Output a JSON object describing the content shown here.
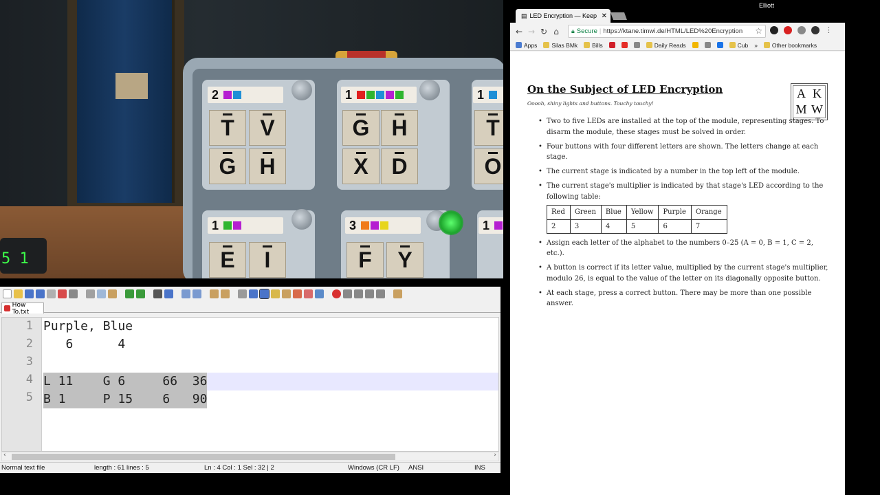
{
  "game": {
    "clock_text": "5 1",
    "modules": [
      {
        "stage": "2",
        "leds": [
          "#b51fd1",
          "#1f8fd6"
        ],
        "letters": [
          "T",
          "V",
          "G",
          "H"
        ]
      },
      {
        "stage": "1",
        "leds": [
          "#e02020",
          "#2fb52f",
          "#1f8fd6",
          "#b51fd1",
          "#2fb52f"
        ],
        "letters": [
          "G",
          "H",
          "X",
          "D"
        ]
      },
      {
        "stage": "1",
        "leds": [
          "#1f8fd6"
        ],
        "letters": [
          "T",
          "O"
        ]
      },
      {
        "stage": "1",
        "leds": [
          "#2fb52f",
          "#b51fd1"
        ],
        "letters": [
          "E",
          "I"
        ]
      },
      {
        "stage": "3",
        "leds": [
          "#f07a18",
          "#b51fd1",
          "#e7d51e"
        ],
        "letters": [
          "F",
          "Y"
        ]
      },
      {
        "stage": "1",
        "leds": [
          "#b51fd1"
        ],
        "letters": []
      }
    ]
  },
  "notepad": {
    "tab_label": "How To.txt",
    "lines": [
      {
        "num": "1",
        "text": "Purple, Blue"
      },
      {
        "num": "2",
        "text": "   6      4"
      },
      {
        "num": "3",
        "text": ""
      },
      {
        "num": "4",
        "text": "L 11    G 6     66  36"
      },
      {
        "num": "5",
        "text": "B 1     P 15    6   90"
      }
    ],
    "status": {
      "type": "Normal text file",
      "length": "length : 61    lines : 5",
      "position": "Ln : 4    Col : 1    Sel : 32 | 2",
      "eol": "Windows (CR LF)",
      "encoding": "ANSI",
      "mode": "INS"
    }
  },
  "os": {
    "user": "Elliott"
  },
  "browser": {
    "tab_title": "LED Encryption — Keep",
    "tab_close": "✕",
    "secure_label": "Secure",
    "url": "https://ktane.timwi.de/HTML/LED%20Encryption",
    "bookmarks": [
      {
        "label": "Apps",
        "color": "#4a7bd0"
      },
      {
        "label": "Silas BMk",
        "color": "#e5c24a"
      },
      {
        "label": "Bills",
        "color": "#e5c24a"
      },
      {
        "label": "",
        "color": "#d0202a"
      },
      {
        "label": "",
        "color": "#e52d27"
      },
      {
        "label": "",
        "color": "#888888"
      },
      {
        "label": "Daily Reads",
        "color": "#e5c24a"
      },
      {
        "label": "",
        "color": "#f2b600"
      },
      {
        "label": "",
        "color": "#888888"
      },
      {
        "label": "",
        "color": "#1a73e8"
      },
      {
        "label": "Cub",
        "color": "#e5c24a"
      },
      {
        "label": "»",
        "color": ""
      },
      {
        "label": "Other bookmarks",
        "color": "#e5c24a"
      }
    ],
    "extensions": [
      "#222222",
      "#d82020",
      "#888888",
      "#333333"
    ]
  },
  "manual": {
    "title": "On the Subject of LED Encryption",
    "flavour": "Ooooh, shiny lights and buttons. Touchy touchy!",
    "logo_letters": [
      "A",
      "K",
      "M",
      "W"
    ],
    "rules": [
      "Two to five LEDs are installed at the top of the module, representing stages. To disarm the module, these stages must be solved in order.",
      "Four buttons with four different letters are shown. The letters change at each stage.",
      "The current stage is indicated by a number in the top left of the module.",
      "The current stage's multiplier is indicated by that stage's LED according to the following table:",
      "Assign each letter of the alphabet to the numbers 0–25 (A = 0, B = 1, C = 2, etc.).",
      "A button is correct if its letter value, multiplied by the current stage's multiplier, modulo 26, is equal to the value of the letter on its diagonally opposite button.",
      "At each stage, press a correct button. There may be more than one possible answer."
    ],
    "table": {
      "headers": [
        "Red",
        "Green",
        "Blue",
        "Yellow",
        "Purple",
        "Orange"
      ],
      "values": [
        "2",
        "3",
        "4",
        "5",
        "6",
        "7"
      ]
    }
  }
}
